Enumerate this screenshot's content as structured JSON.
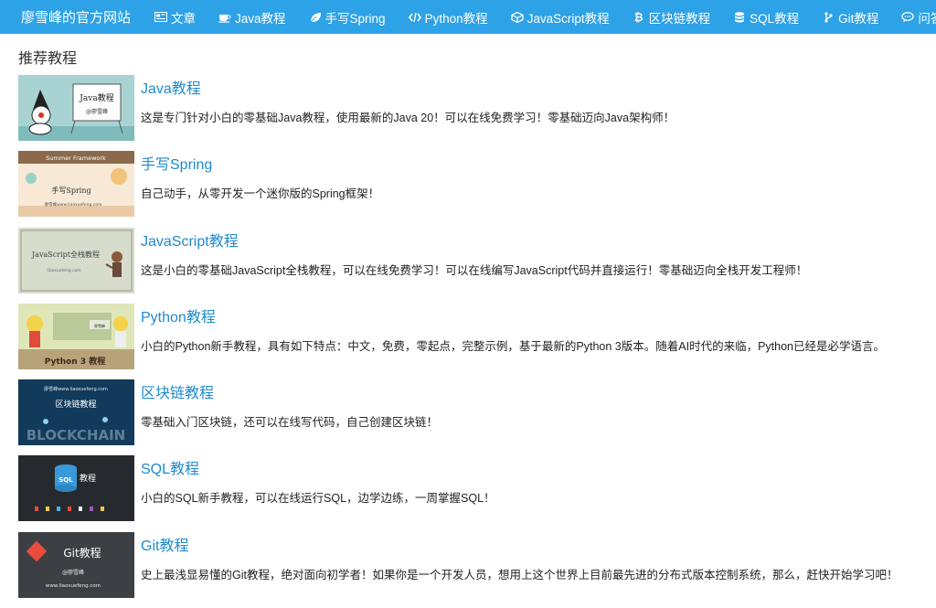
{
  "header": {
    "brand": "廖雪峰的官方网站",
    "nav": [
      {
        "label": "文章",
        "icon": "article-icon"
      },
      {
        "label": "Java教程",
        "icon": "coffee-icon"
      },
      {
        "label": "手写Spring",
        "icon": "leaf-icon"
      },
      {
        "label": "Python教程",
        "icon": "code-icon"
      },
      {
        "label": "JavaScript教程",
        "icon": "cube-icon"
      },
      {
        "label": "区块链教程",
        "icon": "bitcoin-icon"
      },
      {
        "label": "SQL教程",
        "icon": "database-icon"
      },
      {
        "label": "Git教程",
        "icon": "git-icon"
      },
      {
        "label": "问答",
        "icon": "chat-icon"
      }
    ]
  },
  "main": {
    "section_title": "推荐教程",
    "courses": [
      {
        "title": "Java教程",
        "desc": "这是专门针对小白的零基础Java教程，使用最新的Java 20！可以在线免费学习！零基础迈向Java架构师！",
        "thumb": {
          "text1": "Java教程",
          "text2": "@廖雪峰"
        }
      },
      {
        "title": "手写Spring",
        "desc": "自己动手，从零开发一个迷你版的Spring框架！",
        "thumb": {
          "text1": "Summer Framework",
          "text2": "手写Spring",
          "text3": "廖雪峰www.liaoxuefeng.com"
        }
      },
      {
        "title": "JavaScript教程",
        "desc": "这是小白的零基础JavaScript全栈教程，可以在线免费学习！可以在线编写JavaScript代码并直接运行！零基础迈向全栈开发工程师！",
        "thumb": {
          "text1": "JavaScript全栈教程",
          "text2": "liaoxuefeng.com"
        }
      },
      {
        "title": "Python教程",
        "desc": "小白的Python新手教程，具有如下特点：中文，免费，零起点，完整示例，基于最新的Python 3版本。随着AI时代的来临，Python已经是必学语言。",
        "thumb": {
          "text1": "Python 3 教程",
          "text2": "廖雪峰"
        }
      },
      {
        "title": "区块链教程",
        "desc": "零基础入门区块链，还可以在线写代码，自己创建区块链！",
        "thumb": {
          "text1": "廖雪峰www.liaoxuefeng.com",
          "text2": "区块链教程",
          "text3": "BLOCKCHAIN"
        }
      },
      {
        "title": "SQL教程",
        "desc": "小白的SQL新手教程，可以在线运行SQL，边学边练，一周掌握SQL！",
        "thumb": {
          "text1": "SQL",
          "text2": "教程"
        }
      },
      {
        "title": "Git教程",
        "desc": "史上最浅显易懂的Git教程，绝对面向初学者！如果你是一个开发人员，想用上这个世界上目前最先进的分布式版本控制系统，那么，赶快开始学习吧！",
        "thumb": {
          "text1": "Git教程",
          "text2": "@廖雪峰",
          "text3": "www.liaoxuefeng.com"
        }
      }
    ]
  },
  "colors": {
    "header_bg": "#2ea2e6",
    "link": "#1e8bcf"
  }
}
